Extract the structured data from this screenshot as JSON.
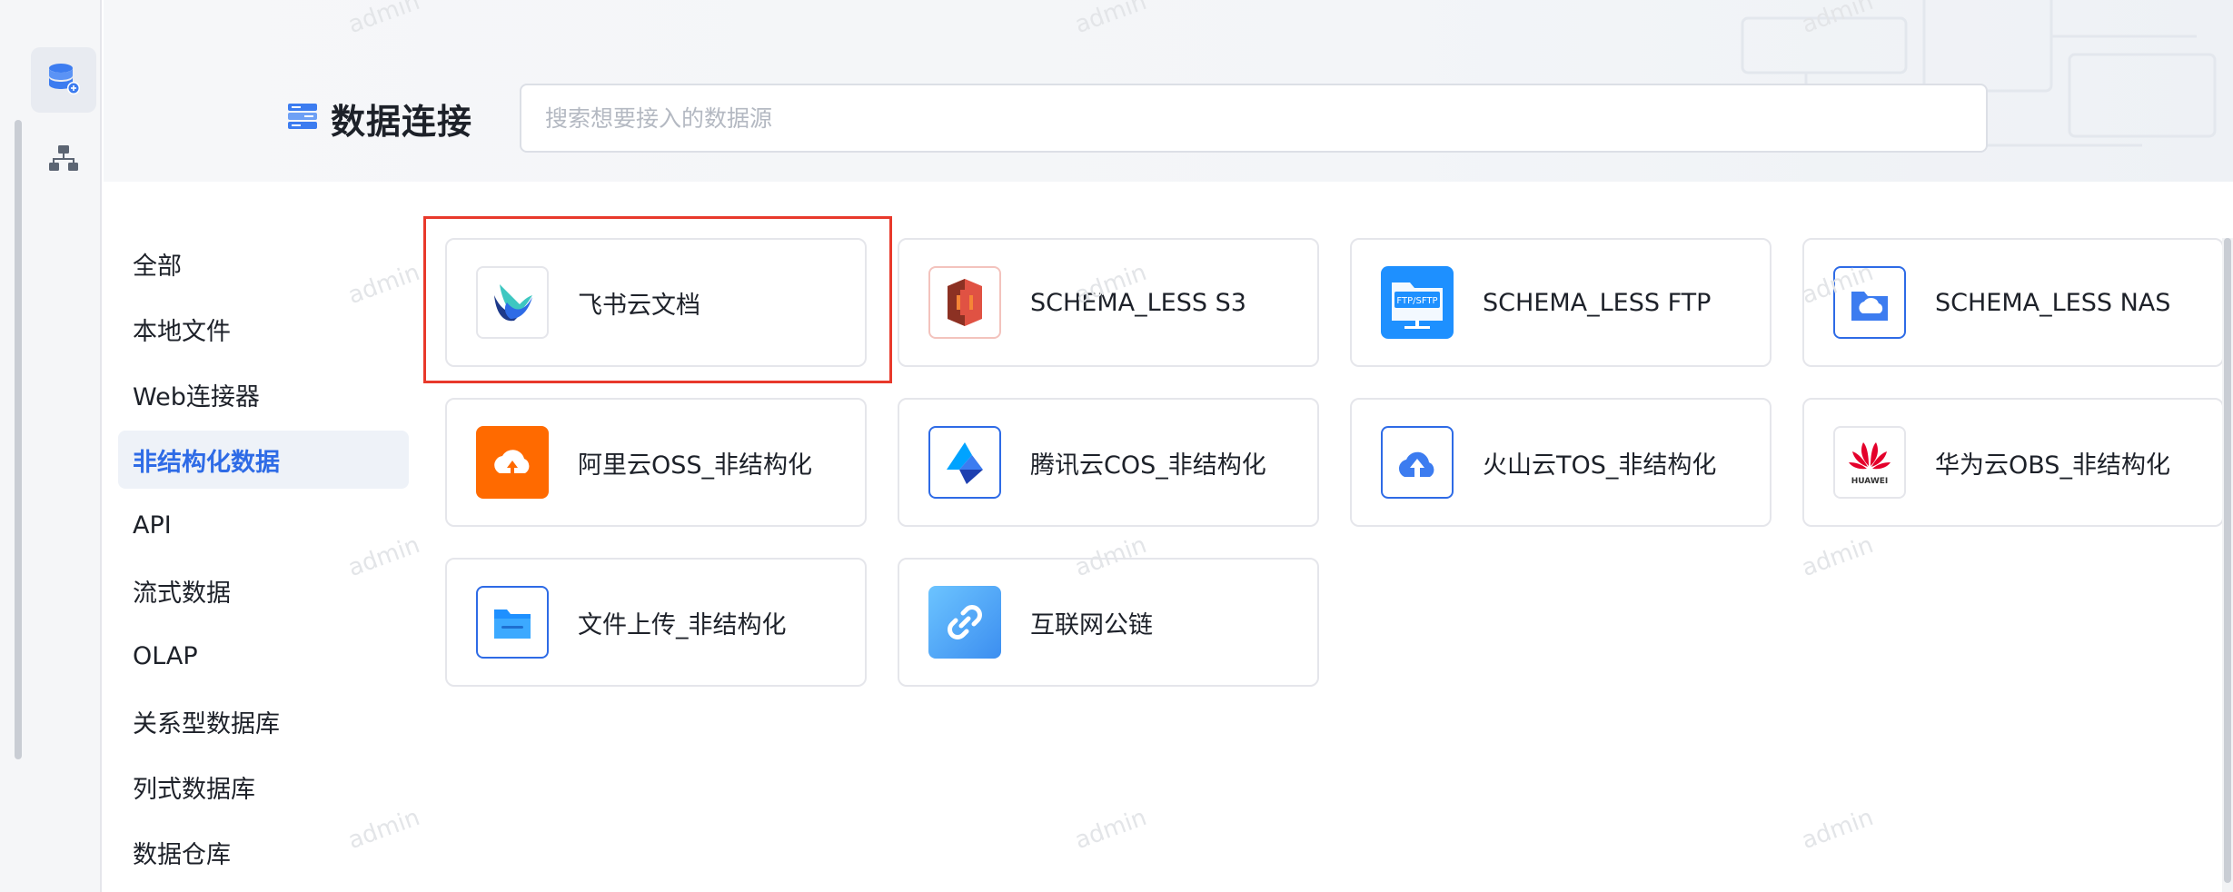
{
  "header": {
    "title": "数据连接",
    "search_placeholder": "搜索想要接入的数据源"
  },
  "watermark": "admin",
  "categories": [
    {
      "label": "全部",
      "active": false
    },
    {
      "label": "本地文件",
      "active": false
    },
    {
      "label": "Web连接器",
      "active": false
    },
    {
      "label": "非结构化数据",
      "active": true
    },
    {
      "label": "API",
      "active": false
    },
    {
      "label": "流式数据",
      "active": false
    },
    {
      "label": "OLAP",
      "active": false
    },
    {
      "label": "关系型数据库",
      "active": false
    },
    {
      "label": "列式数据库",
      "active": false
    },
    {
      "label": "数据仓库",
      "active": false
    }
  ],
  "cards": [
    {
      "label": "飞书云文档",
      "icon": "feishu-icon",
      "highlighted": true
    },
    {
      "label": "SCHEMA_LESS S3",
      "icon": "aws-s3-icon"
    },
    {
      "label": "SCHEMA_LESS FTP",
      "icon": "ftp-folder-icon",
      "icon_text": "FTP/SFTP"
    },
    {
      "label": "SCHEMA_LESS NAS",
      "icon": "nas-cloud-icon"
    },
    {
      "label": "阿里云OSS_非结构化",
      "icon": "aliyun-oss-icon"
    },
    {
      "label": "腾讯云COS_非结构化",
      "icon": "tencent-cos-icon"
    },
    {
      "label": "火山云TOS_非结构化",
      "icon": "volcano-tos-icon"
    },
    {
      "label": "华为云OBS_非结构化",
      "icon": "huawei-obs-icon",
      "icon_text": "HUAWEI"
    },
    {
      "label": "文件上传_非结构化",
      "icon": "file-upload-folder-icon"
    },
    {
      "label": "互联网公链",
      "icon": "link-icon"
    }
  ],
  "colors": {
    "accent": "#2e6be6",
    "highlight_border": "#e8392b",
    "aliyun_orange": "#ff6a00",
    "aws_red": "#d13c2c"
  }
}
